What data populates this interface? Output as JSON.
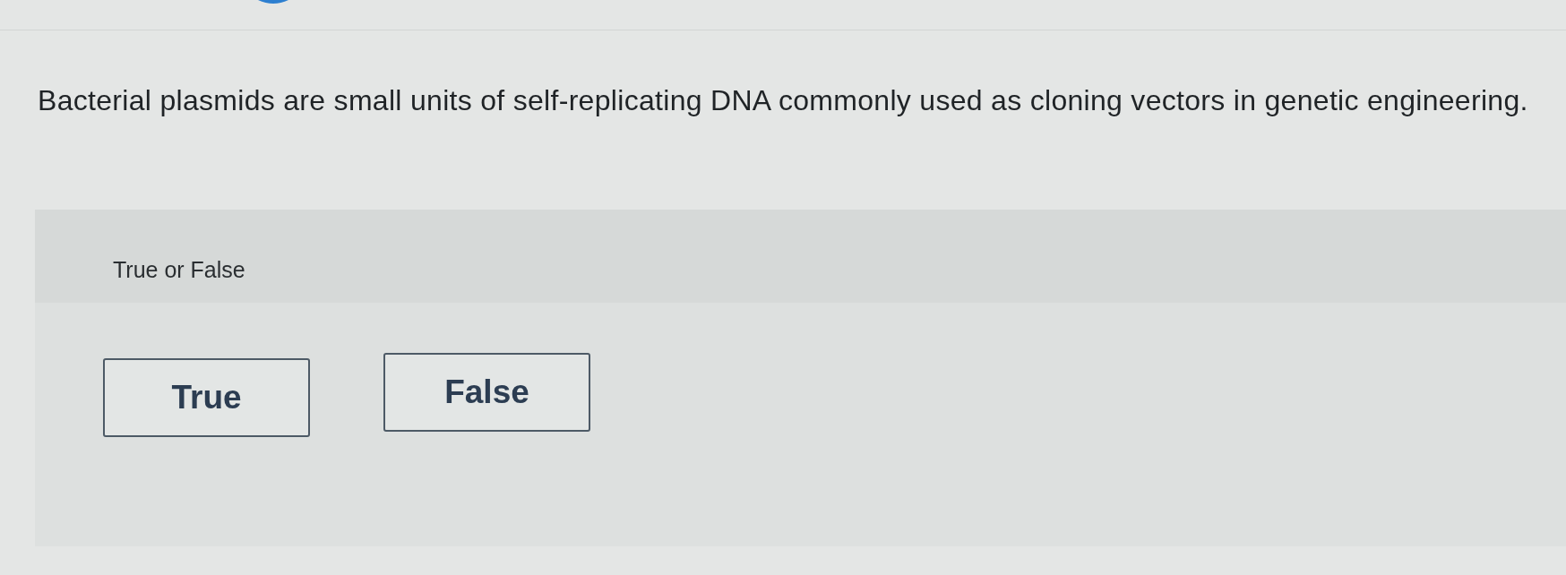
{
  "question": {
    "text": "Bacterial plasmids are small units of self-replicating DNA commonly used as cloning vectors in genetic engineering."
  },
  "prompt": {
    "label": "True or False"
  },
  "choices": [
    {
      "label": "True",
      "selected": false
    },
    {
      "label": "False",
      "selected": false
    }
  ]
}
